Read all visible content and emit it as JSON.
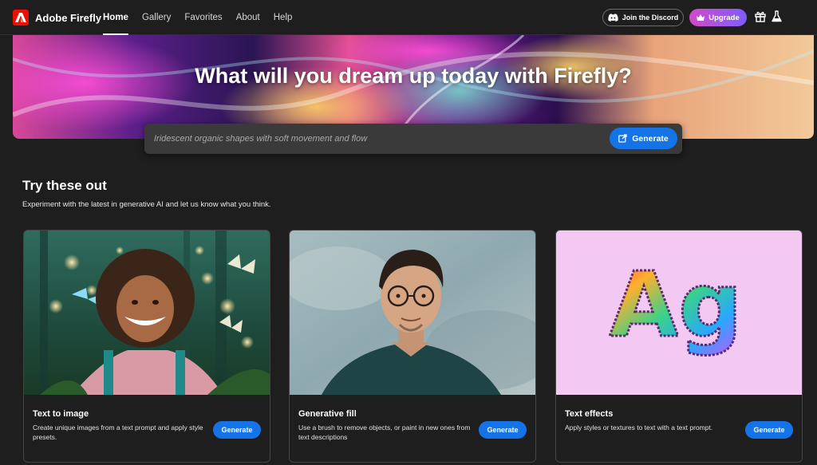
{
  "nav": {
    "brand": "Adobe Firefly",
    "links": [
      "Home",
      "Gallery",
      "Favorites",
      "About",
      "Help"
    ],
    "active": "Home",
    "discord_label": "Join the Discord",
    "upgrade_label": "Upgrade"
  },
  "hero": {
    "title": "What will you dream up today with Firefly?",
    "prompt_placeholder": "Iridescent organic shapes with soft movement and flow",
    "generate_label": "Generate"
  },
  "section": {
    "title": "Try these out",
    "subtitle": "Experiment with the latest in generative AI and let us know what you think."
  },
  "cards": [
    {
      "title": "Text to image",
      "description": "Create unique images from a text prompt and apply style presets.",
      "button": "Generate"
    },
    {
      "title": "Generative fill",
      "description": "Use a brush to remove objects, or paint in new ones from text descriptions",
      "button": "Generate"
    },
    {
      "title": "Text effects",
      "description": "Apply styles or textures to text with a text prompt.",
      "button": "Generate",
      "sample_text": "Ag"
    }
  ],
  "colors": {
    "accent": "#1473e6",
    "brand_red": "#eb1000",
    "background": "#1e1e1e"
  }
}
